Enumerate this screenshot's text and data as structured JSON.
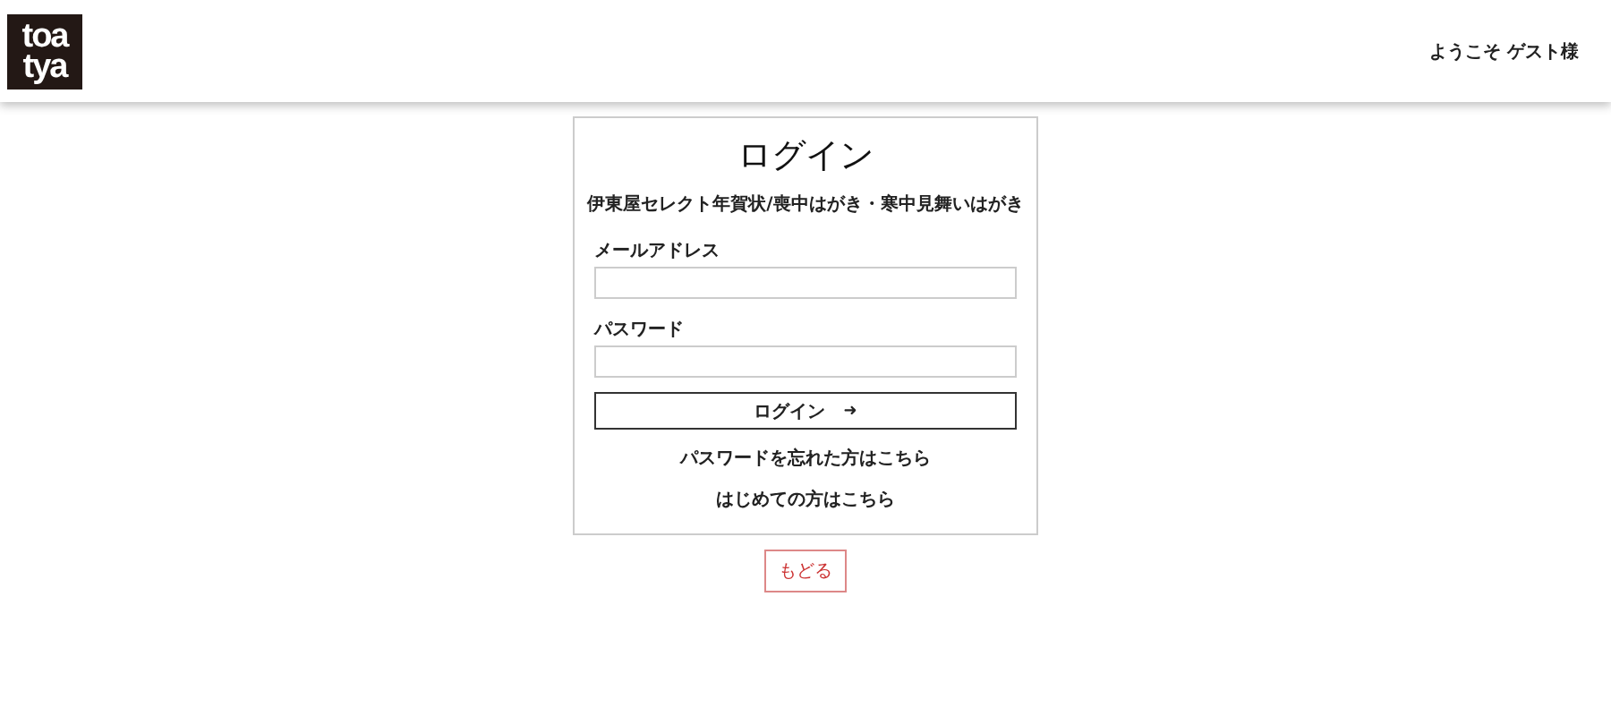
{
  "header": {
    "logo_lines": [
      "toa",
      "tya"
    ],
    "greeting": "ようこそ ゲスト様"
  },
  "login": {
    "title": "ログイン",
    "subtitle": "伊東屋セレクト年賀状/喪中はがき・寒中見舞いはがき",
    "fields": [
      {
        "label": "メールアドレス"
      },
      {
        "label": "パスワード"
      }
    ],
    "submit": {
      "label": "ログイン",
      "icon": "➜"
    },
    "links": [
      "パスワードを忘れた方はこちら",
      "はじめての方はこちら"
    ]
  },
  "back_button": "もどる"
}
